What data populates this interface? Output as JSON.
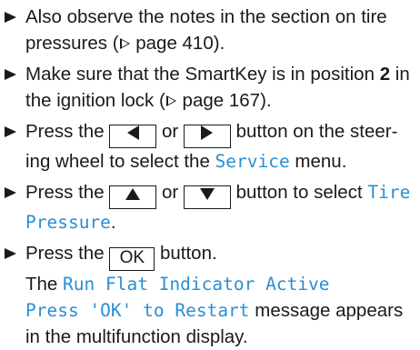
{
  "steps": [
    {
      "text_a": "Also observe the notes in the section on tire pressures (",
      "page_prefix": "page 410",
      "text_b": ")."
    },
    {
      "text_a": "Make sure that the SmartKey is in position ",
      "bold": "2",
      "text_b": " in the ignition lock (",
      "page_prefix": "page 167",
      "text_c": ")."
    },
    {
      "text_a": "Press the ",
      "or": " or ",
      "text_b": " button on the steer-ing wheel to select the ",
      "display": "Service",
      "text_c": " menu."
    },
    {
      "text_a": "Press the ",
      "or": " or ",
      "text_b": " button to select ",
      "display": "Tire Pressure",
      "text_c": "."
    },
    {
      "text_a": "Press the ",
      "key_label": "OK",
      "text_b": " button.",
      "text_c": "The ",
      "display_1": "Run Flat Indicator Active",
      "display_2": "Press 'OK' to Restart",
      "text_d": " message appears in the multifunction display."
    }
  ],
  "icons": [
    "bullet-arrow-icon",
    "page-ref-icon",
    "left-arrow-icon",
    "right-arrow-icon",
    "up-arrow-icon",
    "down-arrow-icon"
  ],
  "colors": {
    "text": "#1a1a1a",
    "display_text": "#2a8fd6"
  }
}
